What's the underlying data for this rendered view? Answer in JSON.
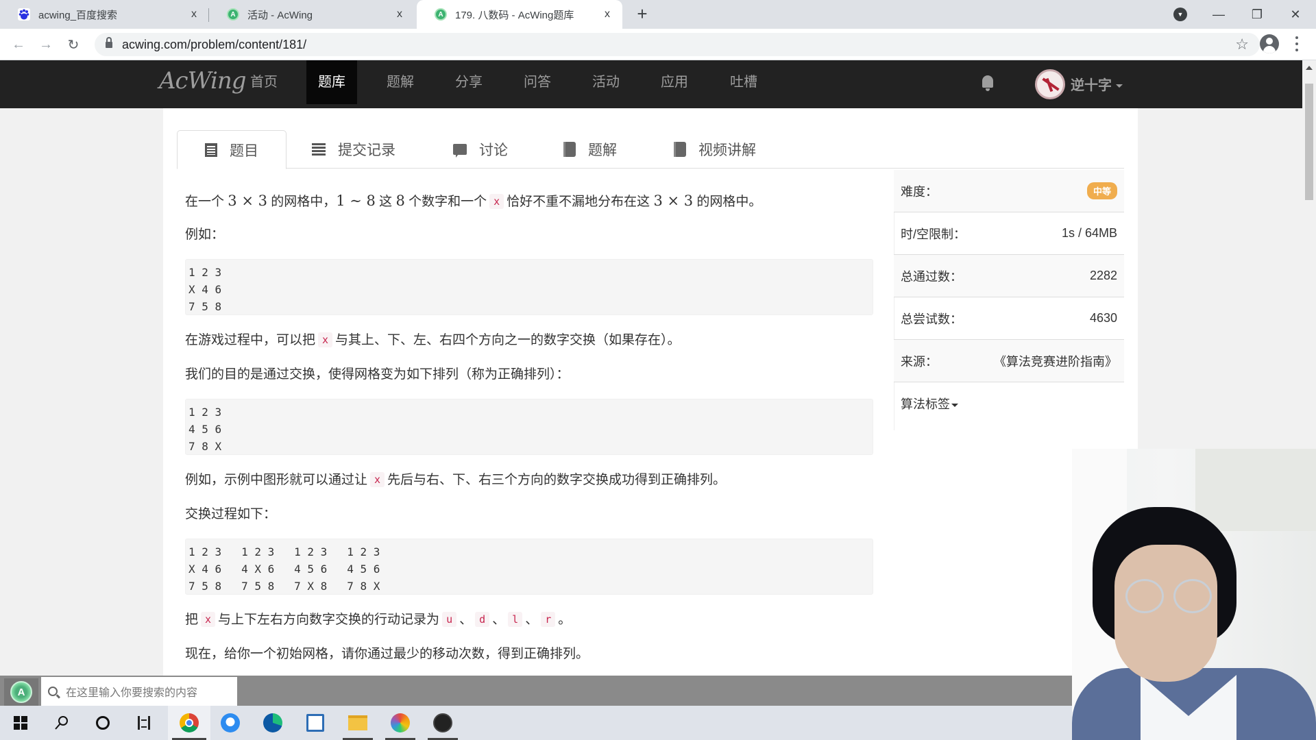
{
  "browser": {
    "tabs": [
      {
        "title": "acwing_百度搜索",
        "favicon": "baidu-paw-icon",
        "active": false
      },
      {
        "title": "活动 - AcWing",
        "favicon": "acwing-icon",
        "active": false
      },
      {
        "title": "179. 八数码 - AcWing题库",
        "favicon": "acwing-icon",
        "active": true
      }
    ],
    "close_glyph": "x",
    "new_tab_glyph": "+",
    "url": "acwing.com/problem/content/181/",
    "window_controls": {
      "minimize": "—",
      "restore": "❐",
      "close": "✕"
    },
    "nav": {
      "back": "←",
      "forward": "→",
      "reload": "↻"
    },
    "star": "☆"
  },
  "site": {
    "logo": "AcWing",
    "nav": [
      "首页",
      "题库",
      "题解",
      "分享",
      "问答",
      "活动",
      "应用",
      "吐槽"
    ],
    "active_nav": "题库",
    "username": "逆十字"
  },
  "problem_tabs": [
    {
      "label": "题目",
      "icon": "document-icon",
      "active": true
    },
    {
      "label": "提交记录",
      "icon": "list-icon",
      "active": false
    },
    {
      "label": "讨论",
      "icon": "comment-icon",
      "active": false
    },
    {
      "label": "题解",
      "icon": "book-icon",
      "active": false
    },
    {
      "label": "视频讲解",
      "icon": "book-icon",
      "active": false
    }
  ],
  "description": {
    "p1_a": "在一个 ",
    "p1_math1": "3 × 3",
    "p1_b": " 的网格中，",
    "p1_math2": "1 ∼ 8",
    "p1_c": " 这 ",
    "p1_math3": "8",
    "p1_d": " 个数字和一个",
    "p1_code": "x",
    "p1_e": "恰好不重不漏地分布在这 ",
    "p1_math4": "3 × 3",
    "p1_f": " 的网格中。",
    "p2": "例如：",
    "pre1": "1 2 3\nX 4 6\n7 5 8",
    "p3_a": "在游戏过程中，可以把",
    "p3_code": "x",
    "p3_b": "与其上、下、左、右四个方向之一的数字交换（如果存在）。",
    "p4": "我们的目的是通过交换，使得网格变为如下排列（称为正确排列）：",
    "pre2": "1 2 3\n4 5 6\n7 8 X",
    "p5_a": "例如，示例中图形就可以通过让",
    "p5_code": "x",
    "p5_b": "先后与右、下、右三个方向的数字交换成功得到正确排列。",
    "p6": "交换过程如下：",
    "pre3": "1 2 3   1 2 3   1 2 3   1 2 3\nX 4 6   4 X 6   4 5 6   4 5 6\n7 5 8   7 5 8   7 X 8   7 8 X",
    "p7_a": "把",
    "p7_code_x": "x",
    "p7_b": "与上下左右方向数字交换的行动记录为",
    "p7_u": "u",
    "p7_d": "d",
    "p7_l": "l",
    "p7_r": "r",
    "sep": "、",
    "end": "。",
    "p8": "现在，给你一个初始网格，请你通过最少的移动次数，得到正确排列。"
  },
  "sidebar": {
    "difficulty_label": "难度：",
    "difficulty": "中等",
    "difficulty_color": "#f0ad4e",
    "limit_label": "时/空限制：",
    "limit": "1s / 64MB",
    "accepted_label": "总通过数：",
    "accepted": "2282",
    "attempts_label": "总尝试数：",
    "attempts": "4630",
    "source_label": "来源：",
    "source": "《算法竞赛进阶指南》",
    "tags_label": "算法标签"
  },
  "taskbar": {
    "search_placeholder": "在这里输入你要搜索的内容",
    "apps": [
      "start",
      "search",
      "cortana",
      "task-view",
      "chrome",
      "qq-browser",
      "edge",
      "control-panel",
      "file-explorer",
      "color-app",
      "obs"
    ]
  }
}
